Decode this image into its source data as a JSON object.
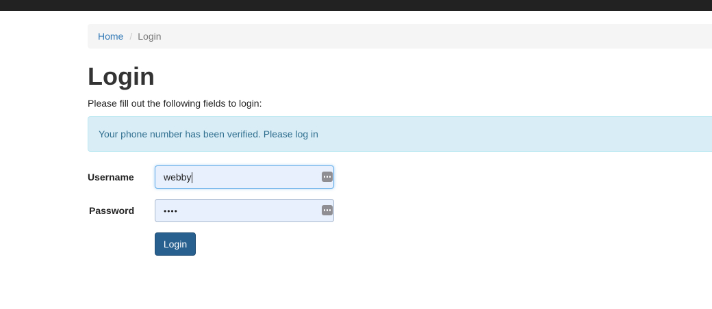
{
  "breadcrumb": {
    "home": "Home",
    "separator": "/",
    "current": "Login"
  },
  "page": {
    "title": "Login",
    "intro": "Please fill out the following fields to login:"
  },
  "alert": {
    "message": "Your phone number has been verified. Please log in"
  },
  "form": {
    "username_label": "Username",
    "username_value": "webby",
    "password_label": "Password",
    "password_mask": "••••",
    "submit_label": "Login"
  },
  "icons": {
    "autofill": "password-manager-key-icon"
  },
  "colors": {
    "topbar": "#222222",
    "link": "#337ab7",
    "alert_bg": "#d9edf7",
    "alert_text": "#31708f",
    "primary_button": "#286090",
    "autofill_bg": "#e8f0fe"
  }
}
